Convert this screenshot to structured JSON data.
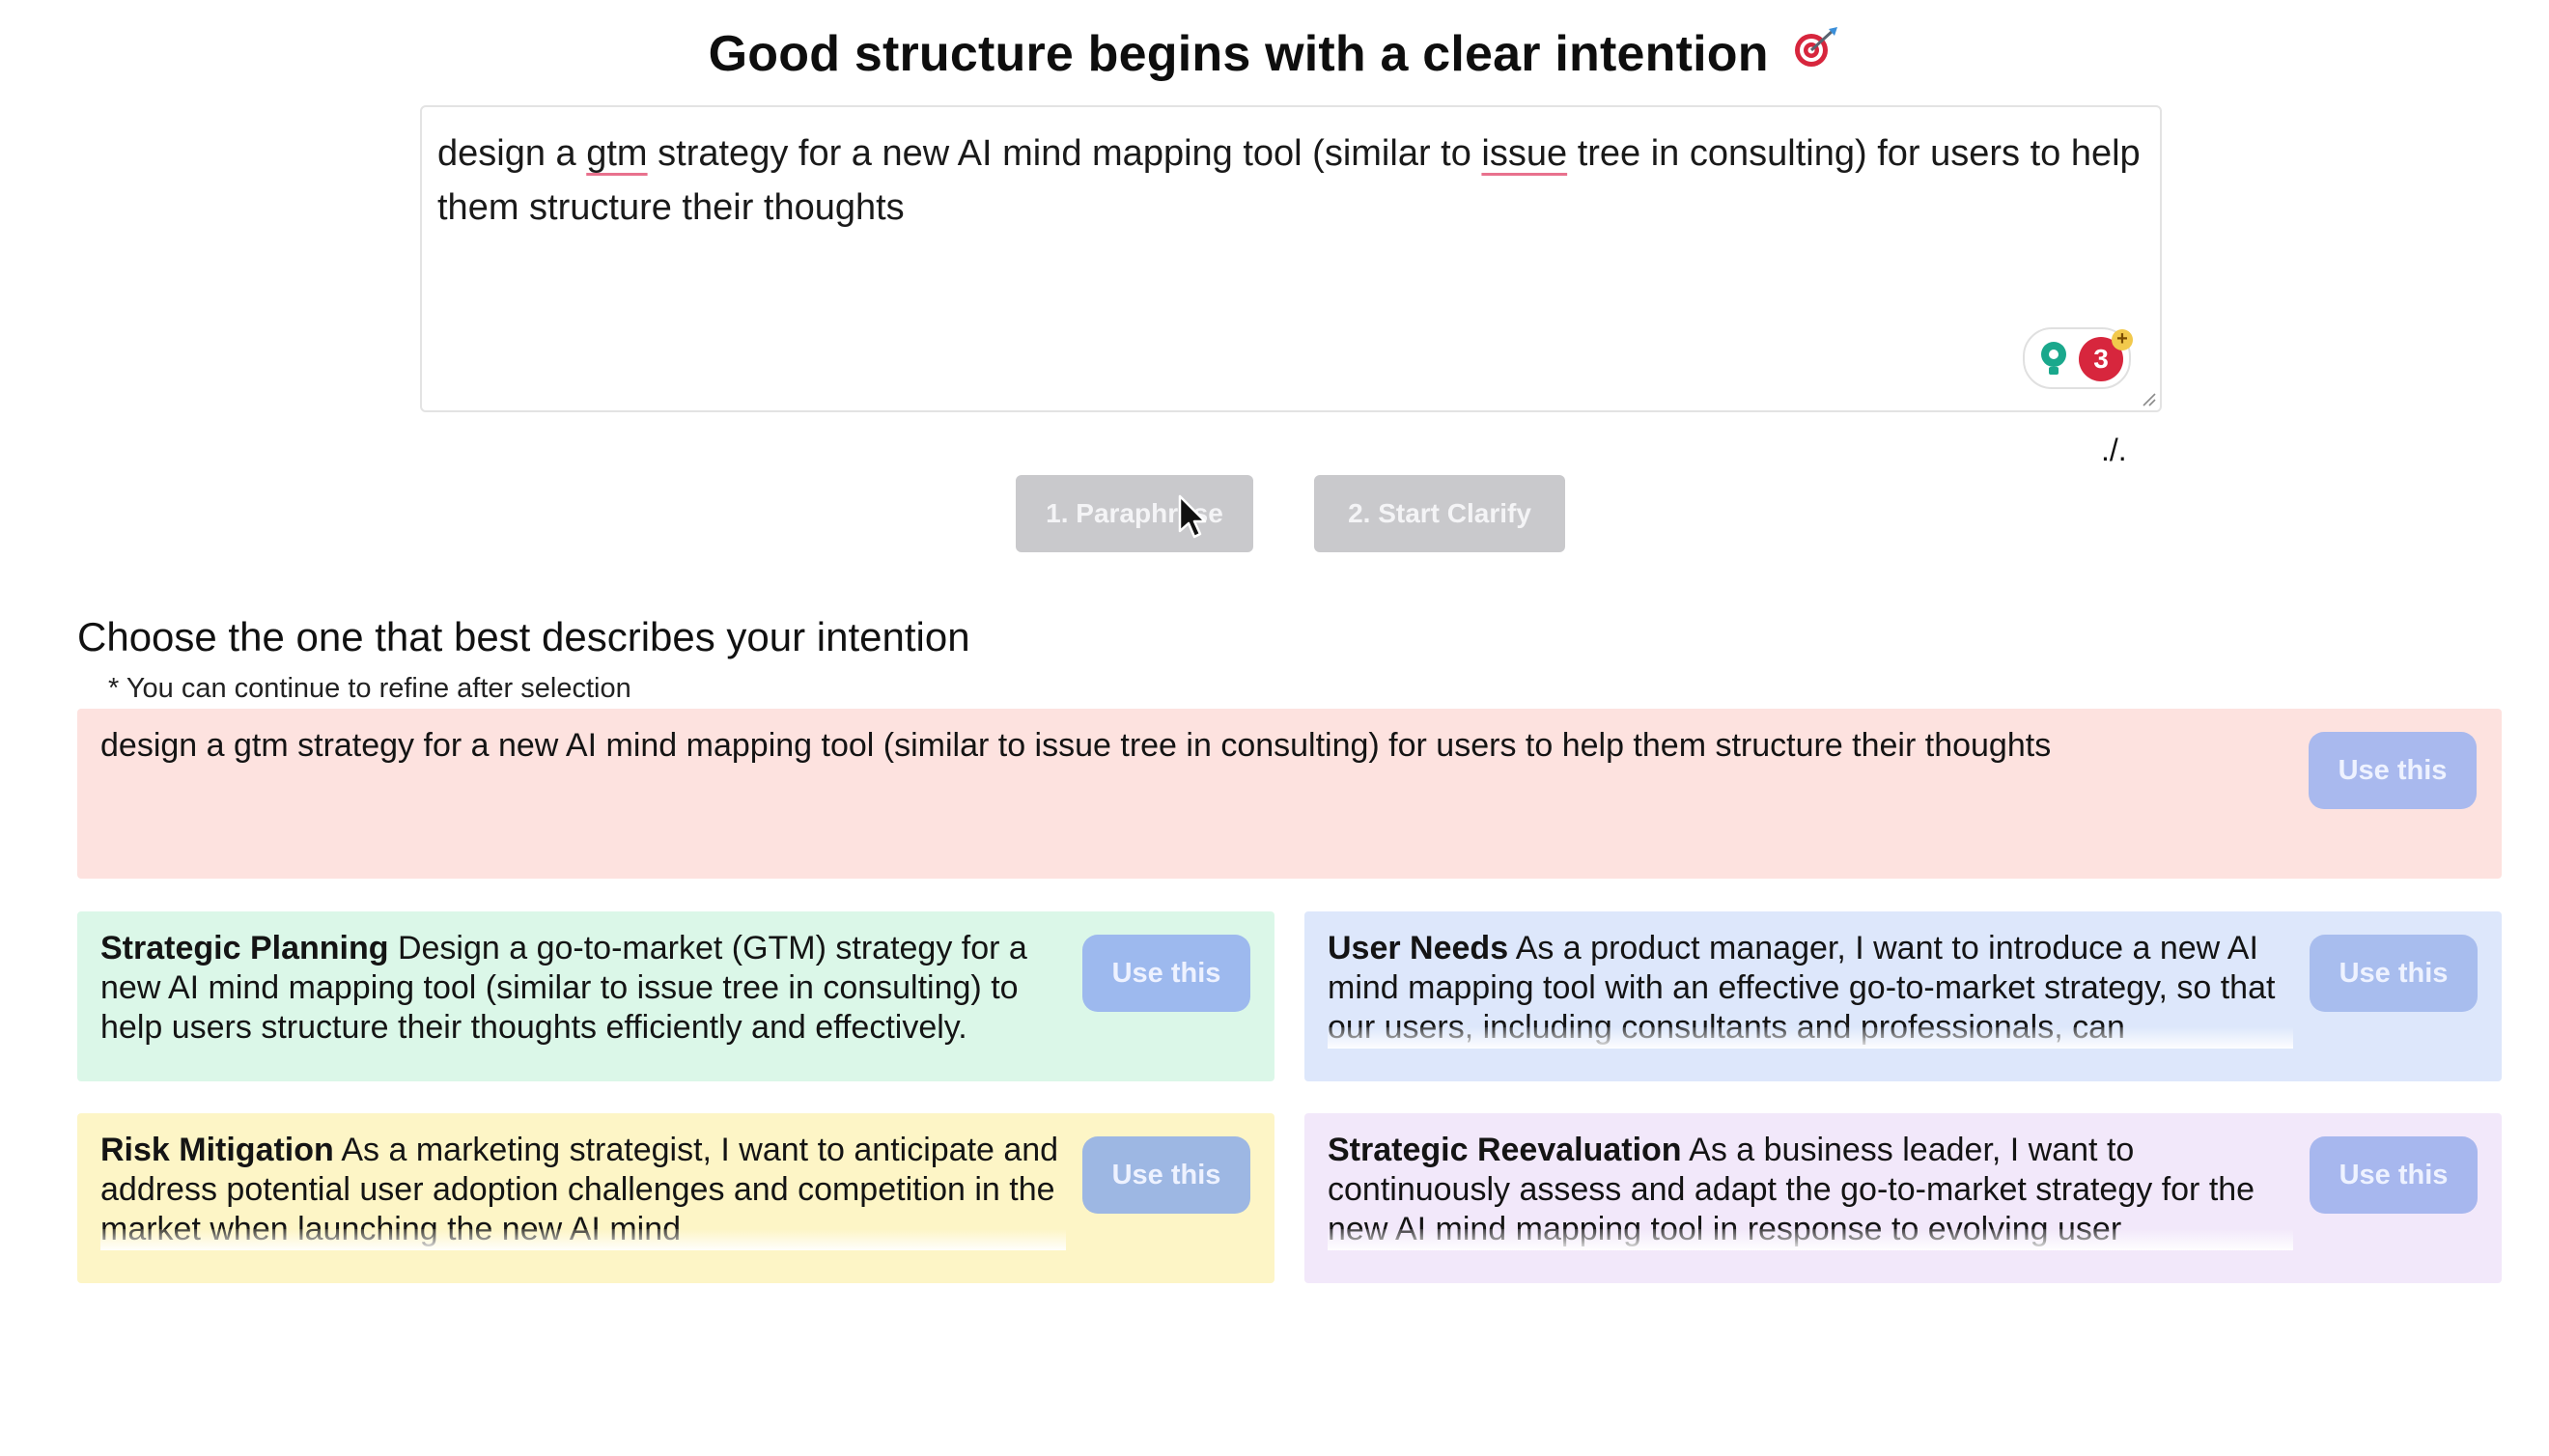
{
  "header": {
    "title": "Good structure begins with a clear intention",
    "title_icon": "target-dart-icon"
  },
  "input": {
    "before_1": "design a ",
    "misspelled_1": "gtm",
    "middle": " strategy for a new AI mind mapping tool (similar to ",
    "misspelled_2": "issue",
    "after": " tree in consulting) for users to help them structure their thoughts"
  },
  "extension_badge": {
    "count": "3",
    "plus": "+",
    "colors": {
      "bulb": "#1aa88c",
      "count": "#d7263d",
      "plus": "#f2c94c"
    }
  },
  "counter": {
    "text": "./."
  },
  "actions": {
    "paraphrase_label": "1. Paraphrase",
    "clarify_label": "2. Start Clarify"
  },
  "choices": {
    "heading": "Choose the one that best describes your intention",
    "note": "* You can continue to refine after selection",
    "use_label": "Use this",
    "original": {
      "text": "design a gtm strategy for a new AI mind mapping tool (similar to issue tree in consulting) for users to help them structure their thoughts",
      "color": "#fde2df"
    },
    "options": [
      {
        "title": "Strategic Planning",
        "text": "Design a go-to-market (GTM) strategy for a new AI mind mapping tool (similar to issue tree in consulting) to help users structure their thoughts efficiently and effectively.",
        "color": "#dbf7e8"
      },
      {
        "title": "User Needs",
        "text": "As a product manager, I want to introduce a new AI mind mapping tool with an effective go-to-market strategy, so that our users, including consultants and professionals, can",
        "color": "#dde7fb"
      },
      {
        "title": "Risk Mitigation",
        "text": "As a marketing strategist, I want to anticipate and address potential user adoption challenges and competition in the market when launching the new AI mind",
        "color": "#fdf5c6"
      },
      {
        "title": "Strategic Reevaluation",
        "text": "As a business leader, I want to continuously assess and adapt the go-to-market strategy for the new AI mind mapping tool in response to evolving user",
        "color": "#f2e8fa"
      }
    ]
  }
}
